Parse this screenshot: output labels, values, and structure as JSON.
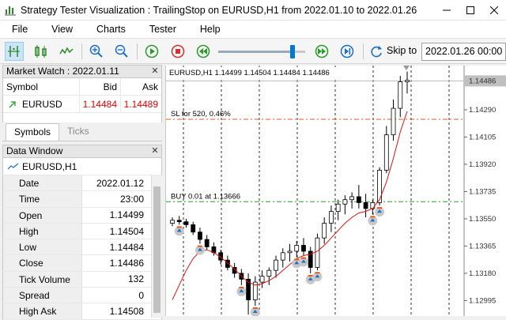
{
  "window": {
    "title": "Strategy Tester Visualization : TrailingStop on EURUSD,H1 from 2022.01.10 to 2022.01.26"
  },
  "menu": [
    "File",
    "View",
    "Charts",
    "Tester",
    "Help"
  ],
  "toolbar": {
    "skip_label": "Skip to",
    "skip_value": "2022.01.26 00:00",
    "speed_fraction": 0.85,
    "icons": [
      "crosshair-icon",
      "bar-chart-icon",
      "candles-icon",
      "line-chart-icon",
      "zoom-in-icon",
      "zoom-out-icon",
      "play-icon",
      "stop-icon",
      "rewind-icon",
      "fast-forward-icon",
      "skip-end-icon",
      "skip-to-icon"
    ]
  },
  "market_watch": {
    "title": "Market Watch : 2022.01.11",
    "headers": [
      "Symbol",
      "Bid",
      "Ask"
    ],
    "rows": [
      {
        "symbol": "EURUSD",
        "bid": "1.14484",
        "ask": "1.14489"
      }
    ],
    "tabs": [
      "Symbols",
      "Ticks"
    ]
  },
  "data_window": {
    "title": "Data Window",
    "symbol": "EURUSD,H1",
    "rows": [
      {
        "key": "Date",
        "value": "2022.01.12"
      },
      {
        "key": "Time",
        "value": "23:00"
      },
      {
        "key": "Open",
        "value": "1.14499"
      },
      {
        "key": "High",
        "value": "1.14504"
      },
      {
        "key": "Low",
        "value": "1.14484"
      },
      {
        "key": "Close",
        "value": "1.14486"
      },
      {
        "key": "Tick Volume",
        "value": "132"
      },
      {
        "key": "Spread",
        "value": "0"
      },
      {
        "key": "High Ask",
        "value": "1.14508"
      }
    ]
  },
  "chart": {
    "header": "EURUSD,H1  1.14499 1.14504 1.14484 1.14486",
    "current_price": "1.14486",
    "price_labels": [
      "1.14290",
      "1.14105",
      "1.13920",
      "1.13735",
      "1.13550",
      "1.13365",
      "1.13180",
      "1.12995"
    ],
    "sl_label": "SL for 520, 0.46%",
    "buy_label": "BUY 0.01 at 1.13666",
    "colors": {
      "sl_line": "#e05a20",
      "buy_line": "#2a9a2a",
      "ma": "#e01010",
      "bull": "#000000"
    }
  },
  "chart_data": {
    "type": "candlestick",
    "y_unit": "price",
    "ylim": [
      1.1289,
      1.1459
    ],
    "sl_price": 1.14225,
    "buy_price": 1.13666,
    "current_price": 1.14486,
    "candles_ohlc": [
      [
        1.1352,
        1.1356,
        1.135,
        1.1354
      ],
      [
        1.1354,
        1.1357,
        1.1351,
        1.1353
      ],
      [
        1.1353,
        1.1355,
        1.1349,
        1.1351
      ],
      [
        1.1351,
        1.1353,
        1.1344,
        1.1346
      ],
      [
        1.1346,
        1.1349,
        1.1338,
        1.1341
      ],
      [
        1.1341,
        1.1344,
        1.1334,
        1.1336
      ],
      [
        1.1336,
        1.1339,
        1.133,
        1.1332
      ],
      [
        1.1332,
        1.1334,
        1.1324,
        1.1327
      ],
      [
        1.1327,
        1.133,
        1.132,
        1.1322
      ],
      [
        1.1322,
        1.1325,
        1.1315,
        1.1318
      ],
      [
        1.1318,
        1.1321,
        1.131,
        1.1314
      ],
      [
        1.1314,
        1.1318,
        1.129,
        1.13
      ],
      [
        1.13,
        1.1316,
        1.1296,
        1.1312
      ],
      [
        1.1312,
        1.132,
        1.1308,
        1.1316
      ],
      [
        1.1316,
        1.1322,
        1.131,
        1.132
      ],
      [
        1.132,
        1.133,
        1.1315,
        1.1327
      ],
      [
        1.1327,
        1.1335,
        1.1322,
        1.1332
      ],
      [
        1.1332,
        1.1338,
        1.1326,
        1.1333
      ],
      [
        1.1333,
        1.134,
        1.1329,
        1.1337
      ],
      [
        1.1337,
        1.1342,
        1.133,
        1.1333
      ],
      [
        1.1333,
        1.1336,
        1.1318,
        1.1322
      ],
      [
        1.1322,
        1.1345,
        1.132,
        1.1342
      ],
      [
        1.1342,
        1.1356,
        1.1338,
        1.1352
      ],
      [
        1.1352,
        1.1364,
        1.1346,
        1.136
      ],
      [
        1.136,
        1.1368,
        1.1354,
        1.1365
      ],
      [
        1.1365,
        1.1371,
        1.1358,
        1.1368
      ],
      [
        1.1368,
        1.1373,
        1.1362,
        1.137
      ],
      [
        1.137,
        1.1378,
        1.1362,
        1.1366
      ],
      [
        1.1366,
        1.1372,
        1.1356,
        1.1362
      ],
      [
        1.1362,
        1.1368,
        1.1358,
        1.1366
      ],
      [
        1.1366,
        1.139,
        1.1364,
        1.1388
      ],
      [
        1.1388,
        1.1418,
        1.1386,
        1.1412
      ],
      [
        1.1412,
        1.1436,
        1.1408,
        1.143
      ],
      [
        1.143,
        1.1452,
        1.1424,
        1.1448
      ],
      [
        1.1448,
        1.1455,
        1.144,
        1.1449
      ]
    ],
    "ma_values": [
      1.13,
      1.131,
      1.132,
      1.1328,
      1.1333,
      1.1334,
      1.1332,
      1.1329,
      1.1325,
      1.1321,
      1.1316,
      1.1312,
      1.131,
      1.1311,
      1.1313,
      1.1316,
      1.132,
      1.1324,
      1.1328,
      1.133,
      1.1331,
      1.1333,
      1.1337,
      1.1342,
      1.1347,
      1.1352,
      1.1356,
      1.1359,
      1.136,
      1.1362,
      1.1368,
      1.138,
      1.1396,
      1.1414,
      1.1428
    ]
  }
}
